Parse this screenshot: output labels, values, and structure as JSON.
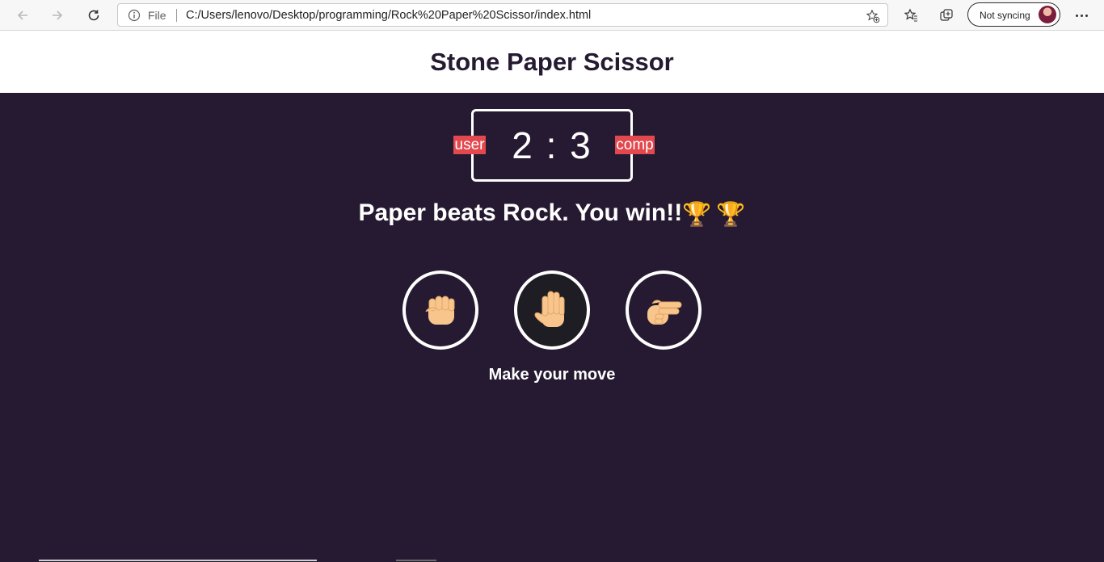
{
  "browser": {
    "scheme_label": "File",
    "url": "C:/Users/lenovo/Desktop/programming/Rock%20Paper%20Scissor/index.html",
    "sync_label": "Not syncing",
    "icons": [
      "back-arrow-icon",
      "forward-arrow-icon",
      "refresh-icon",
      "info-icon",
      "add-favorite-icon",
      "favorites-icon",
      "collections-icon",
      "more-icon"
    ]
  },
  "page": {
    "title": "Stone Paper Scissor",
    "score": {
      "user_label": "user",
      "comp_label": "comp",
      "display": "2 : 3",
      "user_score": 2,
      "comp_score": 3
    },
    "result_message": "Paper beats Rock. You win!!",
    "result_emoji": "🏆",
    "choices": [
      {
        "name": "rock",
        "icon": "fist-icon",
        "selected": false
      },
      {
        "name": "paper",
        "icon": "raised-hand-icon",
        "selected": true
      },
      {
        "name": "scissor",
        "icon": "peace-hand-icon",
        "selected": false
      }
    ],
    "prompt": "Make your move"
  },
  "colors": {
    "background": "#251a31",
    "header_bg": "#ffffff",
    "title_text": "#251a31",
    "badge": "#e2484d",
    "text": "#ffffff",
    "selected_choice_bg": "#1f1d24"
  }
}
